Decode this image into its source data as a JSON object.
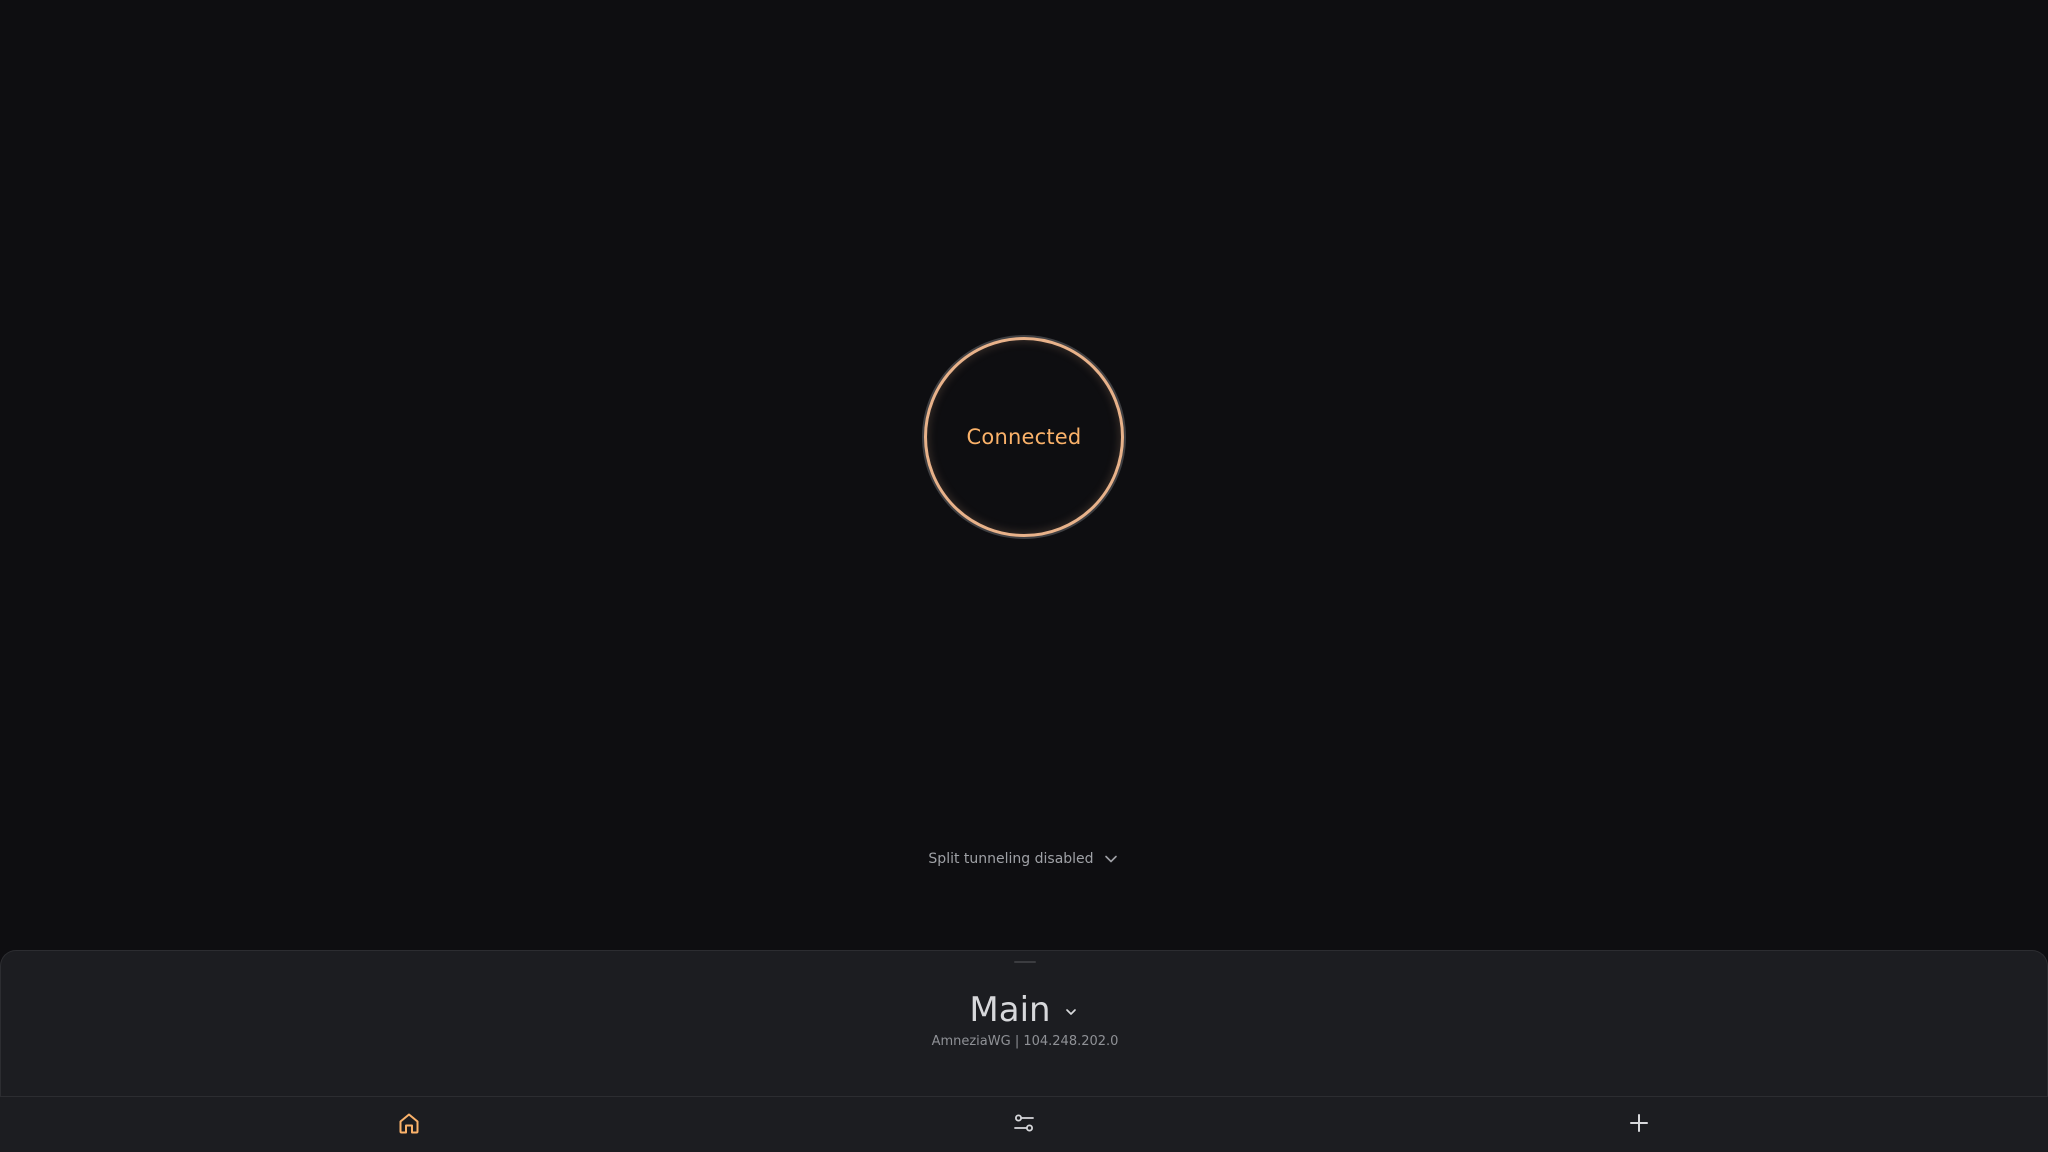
{
  "connection": {
    "status_label": "Connected"
  },
  "split_tunneling": {
    "label": "Split tunneling disabled",
    "icon": "chevron-down-icon"
  },
  "server": {
    "name": "Main",
    "description": "AmneziaWG | 104.248.202.0",
    "icon": "chevron-down-icon"
  },
  "tabs": [
    {
      "id": "home",
      "icon": "home-icon",
      "active": true
    },
    {
      "id": "settings",
      "icon": "settings-sliders-icon",
      "active": false
    },
    {
      "id": "add",
      "icon": "plus-icon",
      "active": false
    }
  ],
  "colors": {
    "background": "#0e0e11",
    "drawer": "#1c1d21",
    "accent": "#fbb26a",
    "ring": "#e8b28a",
    "text_primary": "#d7d8db",
    "text_secondary": "#8f9196"
  }
}
